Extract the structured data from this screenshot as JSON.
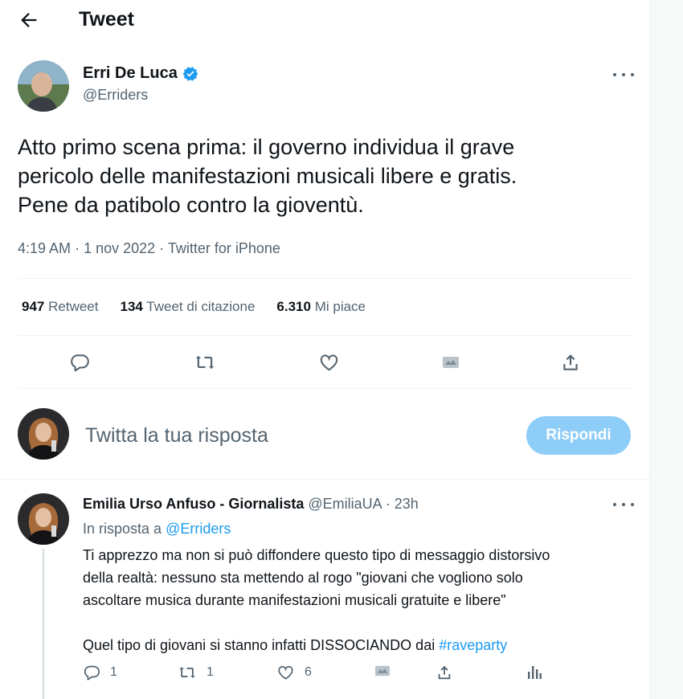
{
  "header": {
    "title": "Tweet",
    "back_icon": "arrow-left-icon"
  },
  "tweet": {
    "author_name": "Erri De Luca",
    "author_handle": "@Erriders",
    "verified_icon": "verified-badge-icon",
    "text_lines": [
      "Atto primo scena prima: il governo individua il grave",
      "pericolo delle manifestazioni musicali libere e gratis.",
      "Pene da patibolo contro la gioventù."
    ],
    "time": "4:19 AM",
    "sep": "·",
    "date": "1 nov 2022",
    "source": "Twitter for iPhone",
    "stats": {
      "retweets_count": "947",
      "retweets_label": "Retweet",
      "quotes_count": "134",
      "quotes_label": "Tweet di citazione",
      "likes_count": "6.310",
      "likes_label": "Mi piace"
    }
  },
  "reply_composer": {
    "placeholder": "Twitta la tua risposta",
    "button_label": "Rispondi"
  },
  "reply": {
    "author_name": "Emilia Urso Anfuso - Giornalista",
    "author_handle": "@EmiliaUA",
    "sep": "·",
    "time": "23h",
    "in_reply_label": "In risposta a",
    "in_reply_handle": "@Erriders",
    "text_lines": [
      "Ti apprezzo ma non si può diffondere questo tipo di messaggio distorsivo",
      "della realtà: nessuno sta mettendo al rogo \"giovani che vogliono solo",
      "ascoltare musica durante manifestazioni musicali gratuite e libere\""
    ],
    "text_line4_prefix": "Quel tipo di giovani si stanno infatti DISSOCIANDO dai",
    "hashtag": "#raveparty",
    "counts": {
      "replies": "1",
      "retweets": "1",
      "likes": "6"
    }
  },
  "colors": {
    "accent": "#1d9bf0",
    "button_disabled": "#8ecdf8",
    "text": "#0f1419",
    "muted": "#536471"
  }
}
